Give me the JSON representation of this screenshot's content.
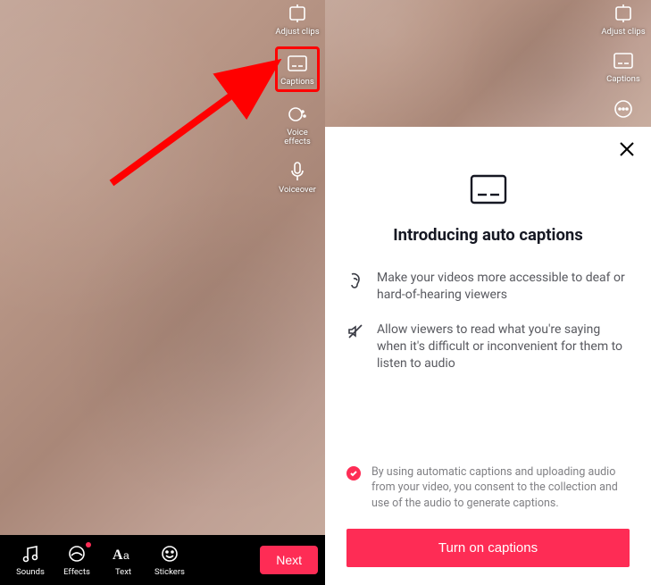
{
  "left": {
    "tools": {
      "adjust": "Adjust clips",
      "captions": "Captions",
      "voiceeffects": "Voice\neffects",
      "voiceover": "Voiceover"
    },
    "bottom": {
      "sounds": "Sounds",
      "effects": "Effects",
      "text": "Text",
      "stickers": "Stickers",
      "next": "Next"
    }
  },
  "right": {
    "tools": {
      "adjust": "Adjust clips",
      "captions": "Captions"
    },
    "modal": {
      "title": "Introducing auto captions",
      "benefit1": "Make your videos more accessible to deaf or hard-of-hearing viewers",
      "benefit2": "Allow viewers to read what you're saying when it's difficult or inconvenient for them to listen to audio",
      "consent": "By using automatic captions and uploading audio from your video, you consent to the collection and use of the audio to generate captions.",
      "turn_on": "Turn on captions"
    }
  }
}
